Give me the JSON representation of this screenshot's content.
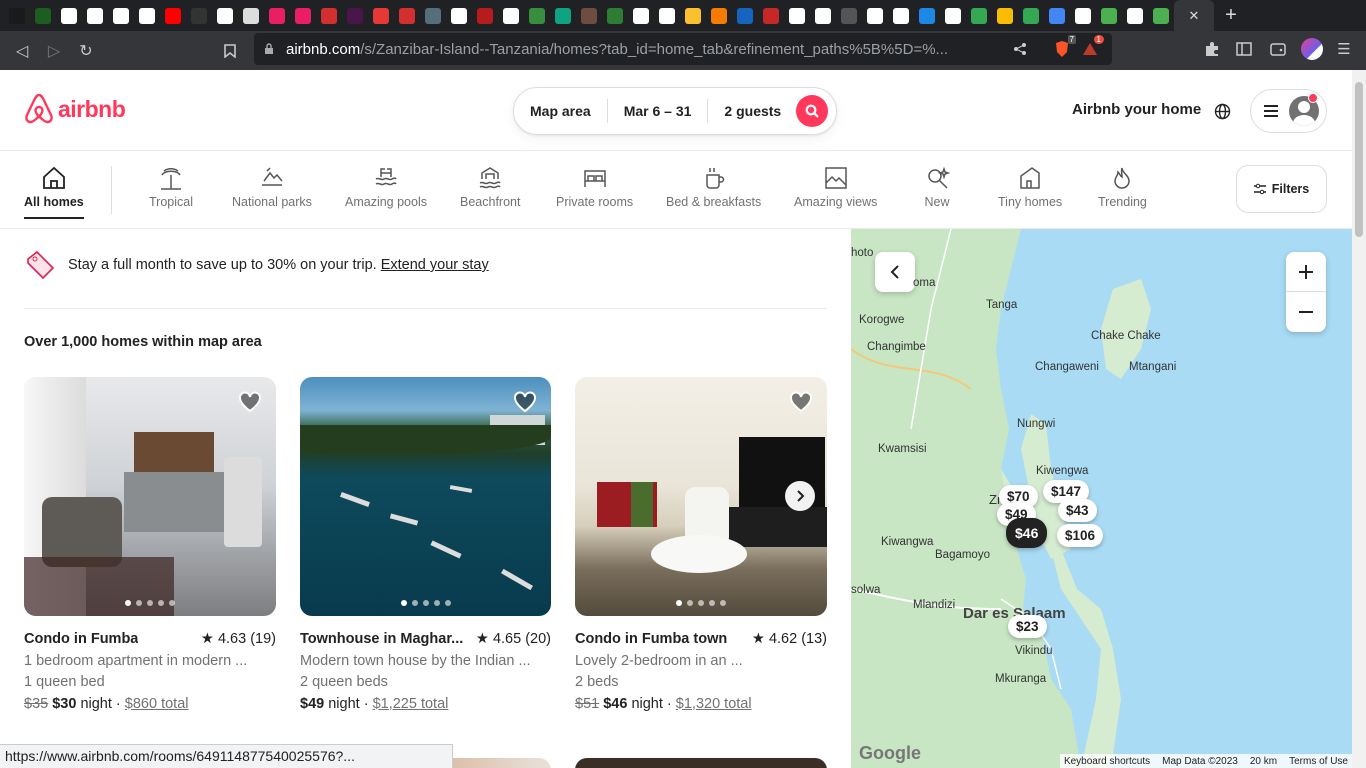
{
  "browser": {
    "tabs": [
      {
        "color": "#1a1a1a",
        "icon": "tab-favicon"
      },
      {
        "color": "#1b5e20",
        "icon": "cn-favicon"
      },
      {
        "color": "#fff",
        "icon": "page-favicon"
      },
      {
        "color": "#fff",
        "icon": "github-favicon"
      },
      {
        "color": "#fff",
        "icon": "github-favicon"
      },
      {
        "color": "#fff",
        "icon": "github-favicon"
      },
      {
        "color": "#ff0000",
        "icon": "youtube-favicon"
      },
      {
        "color": "#333",
        "icon": "tab-favicon"
      },
      {
        "color": "#fff",
        "icon": "github-favicon"
      },
      {
        "color": "#ddd",
        "icon": "tab-favicon"
      },
      {
        "color": "#e91e63",
        "icon": "tab-favicon"
      },
      {
        "color": "#e91e63",
        "icon": "tab-favicon"
      },
      {
        "color": "#d32f2f",
        "icon": "tab-favicon"
      },
      {
        "color": "#4a154b",
        "icon": "slack-favicon"
      },
      {
        "color": "#e53935",
        "icon": "tab-favicon"
      },
      {
        "color": "#d32f2f",
        "icon": "tab-favicon"
      },
      {
        "color": "#546e7a",
        "icon": "tab-favicon"
      },
      {
        "color": "#fff",
        "icon": "tab-favicon"
      },
      {
        "color": "#b71c1c",
        "icon": "tab-favicon"
      },
      {
        "color": "#fff",
        "icon": "github-favicon"
      },
      {
        "color": "#388e3c",
        "icon": "tab-favicon"
      },
      {
        "color": "#10a37f",
        "icon": "openai-favicon"
      },
      {
        "color": "#6d4c41",
        "icon": "tab-favicon"
      },
      {
        "color": "#2e7d32",
        "icon": "tab-favicon"
      },
      {
        "color": "#fff",
        "icon": "tab-favicon"
      },
      {
        "color": "#fff",
        "icon": "tab-favicon"
      },
      {
        "color": "#fbc02d",
        "icon": "tab-favicon"
      },
      {
        "color": "#f57c00",
        "icon": "tab-favicon"
      },
      {
        "color": "#1565c0",
        "icon": "tab-favicon"
      },
      {
        "color": "#c62828",
        "icon": "tab-favicon"
      },
      {
        "color": "#fff",
        "icon": "tab-favicon"
      },
      {
        "color": "#fff",
        "icon": "tab-favicon"
      },
      {
        "color": "#555",
        "icon": "tab-favicon"
      },
      {
        "color": "#fff",
        "icon": "google-favicon"
      },
      {
        "color": "#fff",
        "icon": "tab-favicon"
      },
      {
        "color": "#1e88e5",
        "icon": "tab-favicon"
      },
      {
        "color": "#fff",
        "icon": "github-favicon"
      },
      {
        "color": "#34a853",
        "icon": "drive-favicon"
      },
      {
        "color": "#fbbc04",
        "icon": "tab-favicon"
      },
      {
        "color": "#34a853",
        "icon": "drive-favicon"
      },
      {
        "color": "#4285f4",
        "icon": "docs-favicon"
      },
      {
        "color": "#fff",
        "icon": "tab-favicon"
      },
      {
        "color": "#4caf50",
        "icon": "tab-favicon"
      },
      {
        "color": "#fff",
        "icon": "github-favicon"
      },
      {
        "color": "#4caf50",
        "icon": "tab-favicon"
      }
    ],
    "active_tab_close": "✕",
    "new_tab": "+",
    "url_host": "airbnb.com",
    "url_path": "/s/Zanzibar-Island--Tanzania/homes?tab_id=home_tab&refinement_paths%5B%5D=%...",
    "brave_badge": "7",
    "alert_badge": "1",
    "status_url": "https://www.airbnb.com/rooms/649114877540025576?..."
  },
  "header": {
    "logo_text": "airbnb",
    "search": {
      "where": "Map area",
      "when": "Mar 6 – 31",
      "who": "2 guests"
    },
    "host_link": "Airbnb your home"
  },
  "categories": [
    {
      "label": "All homes",
      "icon": "home-icon",
      "active": true
    },
    {
      "label": "Tropical",
      "icon": "palm-tree-icon"
    },
    {
      "label": "National parks",
      "icon": "national-park-icon"
    },
    {
      "label": "Amazing pools",
      "icon": "pool-icon"
    },
    {
      "label": "Beachfront",
      "icon": "beach-icon"
    },
    {
      "label": "Private rooms",
      "icon": "bed-icon"
    },
    {
      "label": "Bed & breakfasts",
      "icon": "coffee-icon"
    },
    {
      "label": "Amazing views",
      "icon": "view-icon"
    },
    {
      "label": "New",
      "icon": "sparkle-key-icon"
    },
    {
      "label": "Tiny homes",
      "icon": "tiny-home-icon"
    },
    {
      "label": "Trending",
      "icon": "flame-icon"
    }
  ],
  "filters_label": "Filters",
  "banner": {
    "text": "Stay a full month to save up to 30% on your trip.",
    "link": "Extend your stay"
  },
  "results_count": "Over 1,000 homes within map area",
  "listings": [
    {
      "title": "Condo in Fumba",
      "rating": "★ 4.63 (19)",
      "desc": "1 bedroom apartment in modern ...",
      "beds": "1 queen bed",
      "old_price": "$35",
      "price": "$30",
      "unit": "night",
      "total": "$860 total"
    },
    {
      "title": "Townhouse in Maghar...",
      "rating": "★ 4.65 (20)",
      "desc": "Modern town house by the Indian ...",
      "beds": "2 queen beds",
      "old_price": "",
      "price": "$49",
      "unit": "night",
      "total": "$1,225 total"
    },
    {
      "title": "Condo in Fumba town",
      "rating": "★ 4.62 (13)",
      "desc": "Lovely 2-bedroom in an ...",
      "beds": "2 beds",
      "old_price": "$51",
      "price": "$46",
      "unit": "night",
      "total": "$1,320 total"
    }
  ],
  "map": {
    "towns": [
      "hoto",
      "oma",
      "Tanga",
      "Korogwe",
      "Changimbe",
      "Chake Chake",
      "Changaweni",
      "Mtangani",
      "Nungwi",
      "Kwamsisi",
      "Kiwengwa",
      "Kiwangwa",
      "Bagamoyo",
      "solwa",
      "Mlandizi",
      "Dar es Salaam",
      "Vikindu",
      "Mkuranga",
      "Zn"
    ],
    "pins": [
      "$70",
      "$147",
      "$49",
      "$43",
      "$46",
      "$106",
      "$23"
    ],
    "footer": [
      "Keyboard shortcuts",
      "Map Data ©2023",
      "20 km",
      "Terms of Use"
    ],
    "google": "Google"
  }
}
